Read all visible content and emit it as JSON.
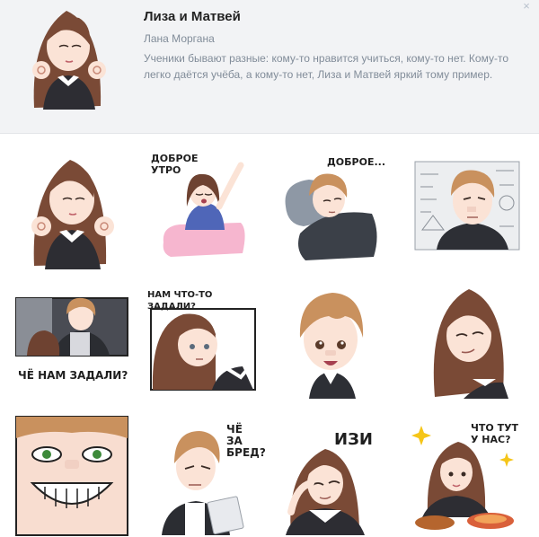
{
  "pack": {
    "title": "Лиза и Матвей",
    "author": "Лана Моргана",
    "description": "Ученики бывают разные: кому-то нравится учиться, кому-то нет. Кому-то легко даётся учёба, а кому-то нет, Лиза и Матвей яркий тому пример."
  },
  "close_icon": "×",
  "stickers": [
    {
      "name": "liza-ok-gesture",
      "caption": ""
    },
    {
      "name": "liza-good-morning",
      "caption": "ДОБРОЕ\nУТРО"
    },
    {
      "name": "matvey-good-morning",
      "caption": "ДОБРОЕ..."
    },
    {
      "name": "matvey-math",
      "caption": ""
    },
    {
      "name": "matvey-what-homework",
      "caption": "ЧЁ НАМ ЗАДАЛИ?"
    },
    {
      "name": "liza-what-homework",
      "caption": "НАМ ЧТО-ТО ЗАДАЛИ?"
    },
    {
      "name": "matvey-smile",
      "caption": ""
    },
    {
      "name": "liza-smirk",
      "caption": ""
    },
    {
      "name": "matvey-grin",
      "caption": ""
    },
    {
      "name": "matvey-nonsense",
      "caption": "ЧЁ\nЗА\nБРЕД?"
    },
    {
      "name": "liza-easy",
      "caption": "ИЗИ"
    },
    {
      "name": "liza-whats-there",
      "caption": "ЧТО ТУТ\nУ НАС?"
    }
  ],
  "colors": {
    "liza_hair": "#7a4a36",
    "matvey_hair": "#c9915e",
    "skin": "#fbe3d6",
    "header_bg": "#f2f3f5",
    "muted_text": "#818c99"
  }
}
